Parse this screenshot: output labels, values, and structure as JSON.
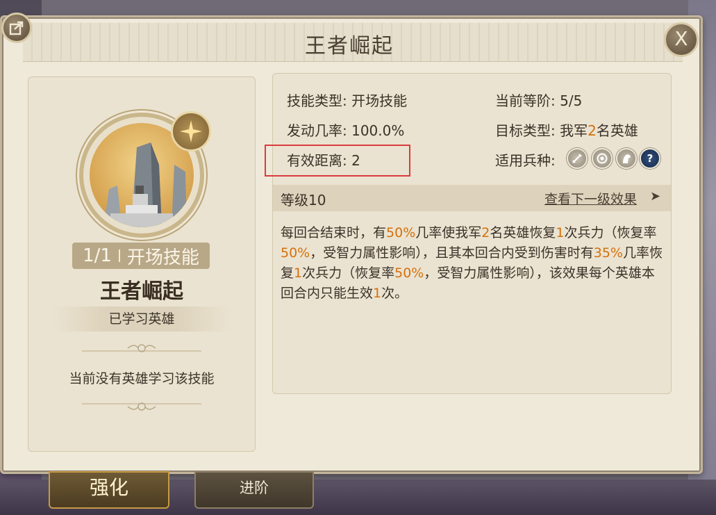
{
  "dialog": {
    "title": "王者崛起"
  },
  "skill_card": {
    "count": "1/1",
    "skill_type_tag": "开场技能",
    "name": "王者崛起",
    "learned_label": "已学习英雄",
    "no_hero_text": "当前没有英雄学习该技能"
  },
  "stats": {
    "skill_type_label": "技能类型:",
    "skill_type_value": "开场技能",
    "current_tier_label": "当前等阶:",
    "current_tier_value": "5/5",
    "trigger_rate_label": "发动几率:",
    "trigger_rate_value": "100.0%",
    "target_type_label": "目标类型:",
    "target_type_prefix": "我军",
    "target_type_number": "2",
    "target_type_suffix": "名英雄",
    "range_label": "有效距离:",
    "range_value": "2",
    "troop_type_label": "适用兵种:",
    "troop_icons": [
      "sword-icon",
      "bow-icon",
      "cavalry-icon",
      "question-icon"
    ],
    "troop_question_glyph": "?"
  },
  "level": {
    "label": "等级10",
    "next_link": "查看下一级效果",
    "next_arrow": "➤"
  },
  "description": {
    "s1": "每回合结束时，有",
    "n1": "50%",
    "s2": "几率使我军",
    "n2": "2",
    "s3": "名英雄恢复",
    "n3": "1",
    "s4": "次兵力（恢复率",
    "n4": "50%",
    "s5": "，受智力属性影响），且其本回合内受到伤害时有",
    "n5": "35%",
    "s6": "几率恢复",
    "n6": "1",
    "s7": "次兵力（恢复率",
    "n7": "50%",
    "s8": "，受智力属性影响），该效果每个英雄本回合内只能生效",
    "n8": "1",
    "s9": "次。"
  },
  "tabs": {
    "strengthen": "强化",
    "advance": "进阶"
  },
  "buttons": {
    "close_glyph": "X"
  },
  "colors": {
    "highlight_number": "#d4700b",
    "annotation_box": "#d93c3c",
    "panel_bg": "#efe9da"
  }
}
